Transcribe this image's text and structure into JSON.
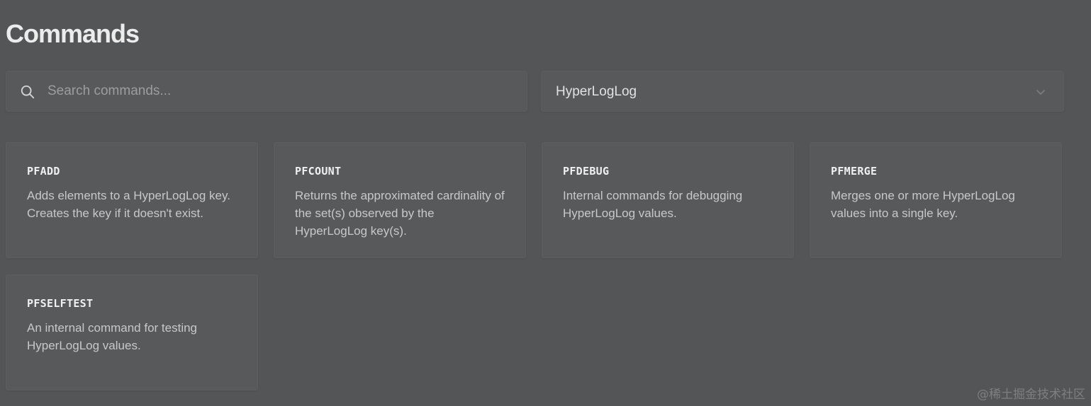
{
  "page": {
    "title": "Commands"
  },
  "search": {
    "placeholder": "Search commands...",
    "value": "",
    "icon": "search-icon"
  },
  "filter": {
    "selected": "HyperLogLog",
    "icon": "chevron-down-icon"
  },
  "commands": [
    {
      "name": "PFADD",
      "description": "Adds elements to a HyperLogLog key. Creates the key if it doesn't exist."
    },
    {
      "name": "PFCOUNT",
      "description": "Returns the approximated cardinality of the set(s) observed by the HyperLogLog key(s)."
    },
    {
      "name": "PFDEBUG",
      "description": "Internal commands for debugging HyperLogLog values."
    },
    {
      "name": "PFMERGE",
      "description": "Merges one or more HyperLogLog values into a single key."
    },
    {
      "name": "PFSELFTEST",
      "description": "An internal command for testing HyperLogLog values."
    }
  ],
  "watermark": "@稀土掘金技术社区",
  "colors": {
    "background": "#545557",
    "surface": "#58595b",
    "text_primary": "#ececec",
    "text_secondary": "#c8c8ca",
    "placeholder": "#9c9d9f"
  }
}
